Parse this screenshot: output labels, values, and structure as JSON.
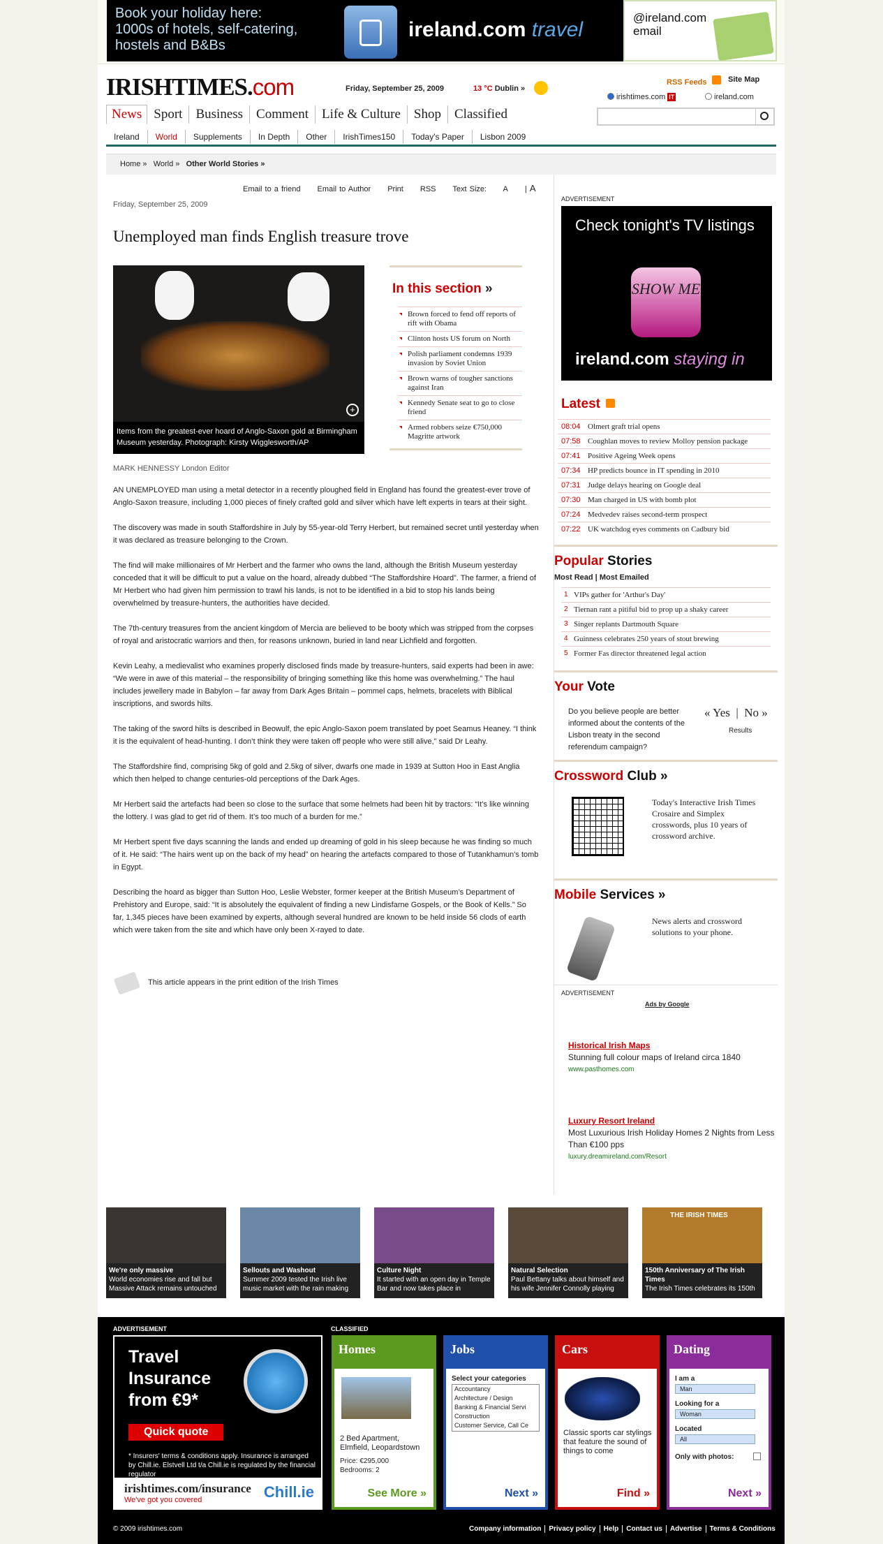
{
  "top_ad": {
    "text_lines": [
      "Book your holiday here:",
      "1000s of hotels, self-catering,",
      "hostels and B&Bs"
    ],
    "brand": "ireland.com",
    "brand_suffix": "travel",
    "mail_text": "@ireland.com",
    "mail_text2": "email"
  },
  "header": {
    "logo_main": "IRISHTIMES.",
    "logo_suffix": "com",
    "date": "Friday, September 25, 2009",
    "temperature": "13 °C",
    "city": "Dublin »",
    "rss": "RSS Feeds",
    "sitemap": "Site Map",
    "search_opt1": "irishtimes.com",
    "search_opt1_badge": "IT",
    "search_opt2": "ireland.com"
  },
  "mainnav": [
    "News",
    "Sport",
    "Business",
    "Comment",
    "Life & Culture",
    "Shop",
    "Classified"
  ],
  "subnav": [
    "Ireland",
    "World",
    "Supplements",
    "In Depth",
    "Other",
    "IrishTimes150",
    "Today's Paper",
    "Lisbon 2009"
  ],
  "breadcrumb": [
    "Home »",
    "World »",
    "Other World Stories »"
  ],
  "tools": [
    "Email to a friend",
    "Email to Author",
    "Print",
    "RSS",
    "Text Size:",
    "A",
    "A"
  ],
  "article": {
    "date": "Friday, September 25, 2009",
    "title": "Unemployed man finds English treasure trove",
    "caption": "Items from the greatest-ever hoard of Anglo-Saxon gold at Birmingham Museum yesterday. Photograph: Kirsty Wigglesworth/AP",
    "byline": "MARK HENNESSY London Editor",
    "paragraphs": [
      "AN UNEMPLOYED man using a metal detector in a recently ploughed field in England has found the greatest-ever trove of Anglo-Saxon treasure, including 1,000 pieces of finely crafted gold and silver which have left experts in tears at their sight.",
      "The discovery was made in south Staffordshire in July by 55-year-old Terry Herbert, but remained secret until yesterday when it was declared as treasure belonging to the Crown.",
      "The find will make millionaires of Mr Herbert and the farmer who owns the land, although the British Museum yesterday conceded that it will be difficult to put a value on the hoard, already dubbed “The Staffordshire Hoard”. The farmer, a friend of Mr Herbert who had given him permission to trawl his lands, is not to be identified in a bid to stop his lands being overwhelmed by treasure-hunters, the authorities have decided.",
      "The 7th-century treasures from the ancient kingdom of Mercia are believed to be booty which was stripped from the corpses of royal and aristocratic warriors and then, for reasons unknown, buried in land near Lichfield and forgotten.",
      "Kevin Leahy, a medievalist who examines properly disclosed finds made by treasure-hunters, said experts had been in awe: “We were in awe of this material – the responsibility of bringing something like this home was overwhelming.” The haul includes jewellery made in Babylon – far away from Dark Ages Britain – pommel caps, helmets, bracelets with Biblical inscriptions, and swords hilts.",
      "The taking of the sword hilts is described in Beowulf, the epic Anglo-Saxon poem translated by poet Seamus Heaney. “I think it is the equivalent of head-hunting. I don’t think they were taken off people who were still alive,” said Dr Leahy.",
      "The Staffordshire find, comprising 5kg of gold and 2.5kg of silver, dwarfs one made in 1939 at Sutton Hoo in East Anglia which then helped to change centuries-old perceptions of the Dark Ages.",
      "Mr Herbert said the artefacts had been so close to the surface that some helmets had been hit by tractors: “It’s like winning the lottery. I was glad to get rid of them. It’s too much of a burden for me.”",
      "Mr Herbert spent five days scanning the lands and ended up dreaming of gold in his sleep because he was finding so much of it. He said: “The hairs went up on the back of my head” on hearing the artefacts compared to those of Tutankhamun’s tomb in Egypt.",
      "Describing the hoard as bigger than Sutton Hoo, Leslie Webster, former keeper at the British Museum’s Department of Prehistory and Europe, said: “It is absolutely the equivalent of finding a new Lindisfarne Gospels, or the Book of Kells.” So far, 1,345 pieces have been examined by experts, although several hundred are known to be held inside 56 clods of earth which were taken from the site and which have only been X-rayed to date."
    ],
    "print_note": "This article appears in the print edition of the Irish Times"
  },
  "in_section": {
    "title": "In this section",
    "arrow": "»",
    "items": [
      "Brown forced to fend off reports of rift with Obama",
      "Clinton hosts US forum on North",
      "Polish parliament condemns 1939 invasion by Soviet Union",
      "Brown warns of tougher sanctions against Iran",
      "Kennedy Senate seat to go to close friend",
      "Armed robbers seize €750,000 Magritte artwork"
    ]
  },
  "right": {
    "ad_label": "ADVERTISEMENT",
    "tv_ad": {
      "text": "Check tonight's TV listings",
      "button": "SHOW ME",
      "brand": "ireland.com",
      "brand_suffix": "staying in"
    },
    "latest_title": "Latest",
    "latest": [
      {
        "time": "08:04",
        "text": "Olmert graft trial opens"
      },
      {
        "time": "07:58",
        "text": "Coughlan moves to review Molloy pension package"
      },
      {
        "time": "07:41",
        "text": "Positive Ageing Week opens"
      },
      {
        "time": "07:34",
        "text": "HP predicts bounce in IT spending in 2010"
      },
      {
        "time": "07:31",
        "text": "Judge delays hearing on Google deal"
      },
      {
        "time": "07:30",
        "text": "Man charged in US with bomb plot"
      },
      {
        "time": "07:24",
        "text": "Medvedev raises second-term prospect"
      },
      {
        "time": "07:22",
        "text": "UK watchdog eyes comments on Cadbury bid"
      }
    ],
    "popular_title_red": "Popular",
    "popular_title_black": "Stories",
    "popular_tabs": [
      "Most Read",
      "Most Emailed"
    ],
    "popular": [
      "VIPs gather for 'Arthur's Day'",
      "Tiernan rant a pitiful bid to prop up a shaky career",
      "Singer replants Dartmouth Square",
      "Guinness celebrates 250 years of stout brewing",
      "Former Fas director threatened legal action"
    ],
    "vote_title_red": "Your",
    "vote_title_black": "Vote",
    "vote_question": "Do you believe people are better informed about the contents of the Lisbon treaty in the second referendum campaign?",
    "vote_yes": "« Yes",
    "vote_no": "No »",
    "vote_results": "Results",
    "crossword_title_red": "Crossword",
    "crossword_title_black": "Club »",
    "crossword_text": "Today's Interactive Irish Times Crosaire and Simplex crosswords, plus 10 years of crossword archive.",
    "mobile_title_red": "Mobile",
    "mobile_title_black": "Services »",
    "mobile_text": "News alerts and crossword solutions to your phone.",
    "ads_by": "Ads by Google",
    "gads": [
      {
        "title": "Historical Irish Maps",
        "text": "Stunning full colour maps of Ireland circa 1840",
        "url": "www.pasthomes.com"
      },
      {
        "title": "Luxury Resort Ireland",
        "text": "Most Luxurious Irish Holiday Homes 2 Nights from Less Than €100 pps",
        "url": "luxury.dreamireland.com/Resort"
      }
    ]
  },
  "thumbs": [
    {
      "title": "We're only massive",
      "text": "World economies rise and fall but Massive Attack remains untouched",
      "color": "#3a3530"
    },
    {
      "title": "Sellouts and Washout",
      "text": "Summer 2009 tested the Irish live music market with the rain making",
      "color": "#6a88a6"
    },
    {
      "title": "Culture Night",
      "text": "It started with an open day in Temple Bar and now takes place in",
      "color": "#7a4b8a"
    },
    {
      "title": "Natural Selection",
      "text": "Paul Bettany talks about himself and his wife Jennifer Connolly playing",
      "color": "#5a4a3a"
    },
    {
      "title": "150th Anniversary of The Irish Times",
      "text": "The Irish Times celebrates its 150th",
      "color": "#b27a2a",
      "badge": "THE IRISH TIMES"
    }
  ],
  "footer": {
    "ad_label": "ADVERTISEMENT",
    "classified_label": "CLASSIFIED",
    "travel": {
      "title": "Travel Insurance from €9*",
      "quick": "Quick quote",
      "fine": "* Insurers' terms & conditions apply. Insurance is arranged by Chill.ie. Elstvell Ltd t/a Chill.ie is regulated by the financial regulator",
      "brand": "irishtimes.com/insurance",
      "tagline": "We've got you covered",
      "chill": "Chill.ie"
    },
    "homes": {
      "title": "Homes",
      "text": "2 Bed Apartment, Elmfield, Leopardstown",
      "price": "Price: €295,000",
      "beds": "Bedrooms: 2",
      "more": "See More »"
    },
    "jobs": {
      "title": "Jobs",
      "label": "Select your categories",
      "options": [
        "Accountancy",
        "Architecture / Design",
        "Banking & Financial Servi",
        "Construction",
        "Customer Service, Call Ce"
      ],
      "more": "Next »"
    },
    "cars": {
      "title": "Cars",
      "text": "Classic sports car stylings that feature the sound of things to come",
      "more": "Find »"
    },
    "dating": {
      "title": "Dating",
      "i_am": "I am a",
      "i_am_val": "Man",
      "looking": "Looking for a",
      "looking_val": "Woman",
      "located": "Located",
      "located_val": "All",
      "photos": "Only with photos:",
      "more": "Next »"
    },
    "copyright": "© 2009 irishtimes.com",
    "links": [
      "Company information",
      "Privacy policy",
      "Help",
      "Contact us",
      "Advertise",
      "Terms & Conditions"
    ]
  },
  "colors": {
    "brand_red": "#cc0000",
    "teal_rule": "#1c6a63",
    "homes": "#5c9a1f",
    "jobs": "#1f4fa8",
    "cars": "#c80f0f",
    "dating": "#8a2c9a"
  }
}
